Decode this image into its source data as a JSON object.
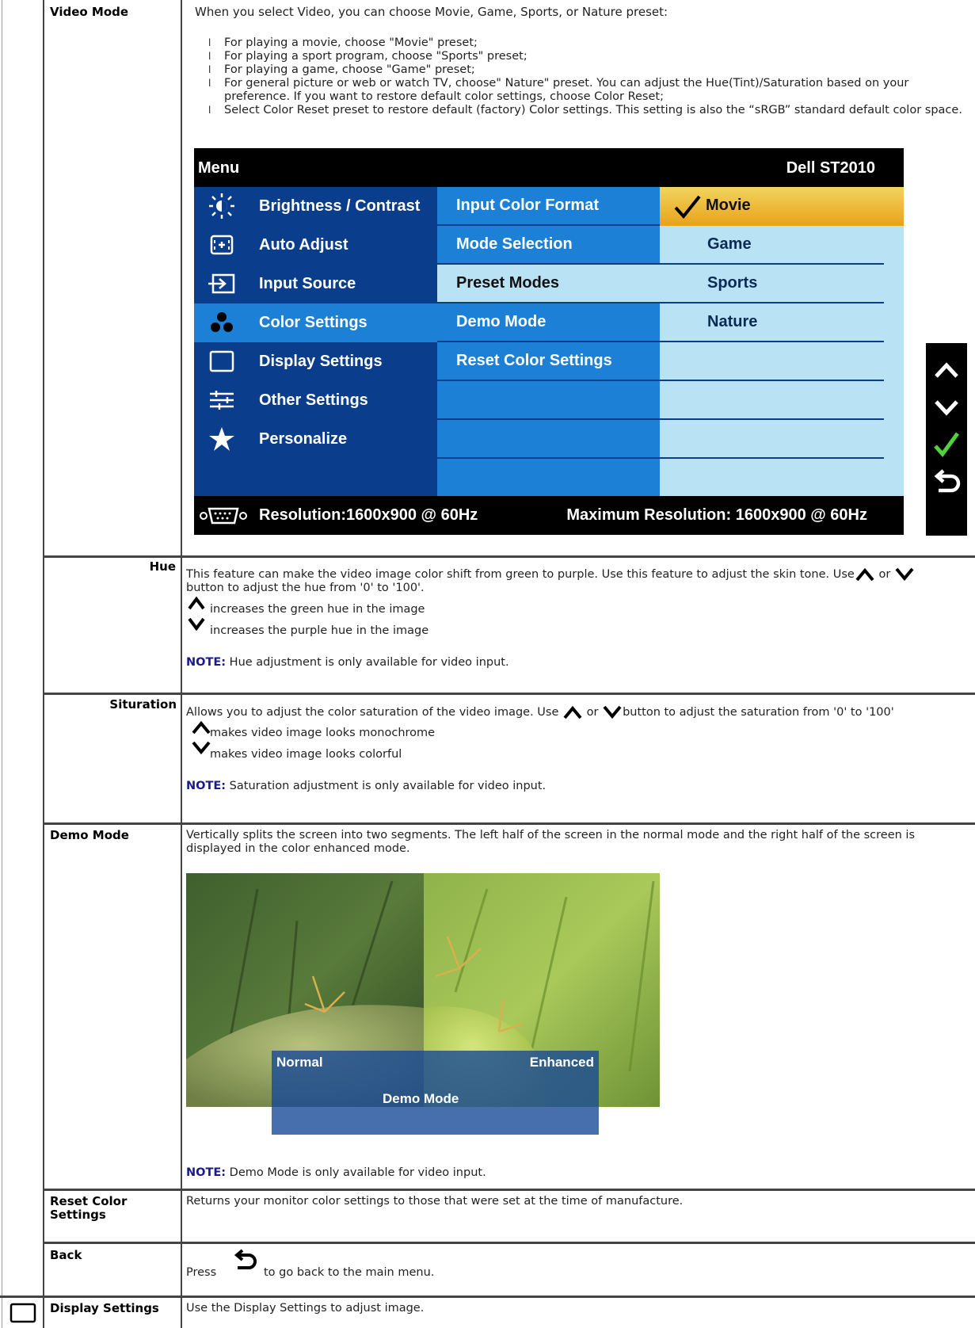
{
  "rows": {
    "video_mode": {
      "label": "Video Mode",
      "intro": "When you select Video, you can choose Movie, Game, Sports, or Nature preset:",
      "bullet_marker": "l",
      "bullets": [
        "For playing a movie, choose \"Movie\" preset;",
        "For playing a sport program, choose \"Sports\" preset;",
        "For playing a game, choose \"Game\" preset;",
        "For general picture or web or watch TV, choose\" Nature\" preset. You can adjust the Hue(Tint)/Saturation based on your preference. If you want to restore default color settings, choose Color Reset;",
        "Select Color Reset preset to restore default (factory) Color settings. This setting is also the “sRGB” standard default color space."
      ]
    },
    "hue": {
      "label": "Hue",
      "desc_a": "This feature can make the video image color shift from green to purple. Use this feature to adjust the skin tone. Use",
      "desc_or": "or",
      "desc_b": "button to adjust the hue from '0' to '100'.",
      "up_text": "increases the green hue in the image",
      "down_text": "increases the purple hue in the image",
      "note_label": "NOTE:",
      "note_text": "Hue adjustment is only available for video input."
    },
    "saturation": {
      "label": "Situration",
      "desc_a": "Allows you to adjust the color saturation of the video image. Use",
      "desc_or": "or",
      "desc_b": "button to adjust the saturation from '0' to '100'",
      "up_text": "makes video image looks monochrome",
      "down_text": "makes video image looks colorful",
      "note_label": "NOTE:",
      "note_text": "Saturation adjustment is only available for video input."
    },
    "demo_mode": {
      "label": "Demo Mode",
      "desc": "Vertically splits the screen into two segments. The left half of the screen in the normal mode and the right half of the screen is displayed in the color enhanced mode.",
      "normal_label": "Normal",
      "enhanced_label": "Enhanced",
      "bar_label": "Demo  Mode",
      "note_label": "NOTE:",
      "note_text": "Demo Mode is only available for video input."
    },
    "reset_color": {
      "label": "Reset Color Settings",
      "desc": "Returns your monitor color settings to those that were set at the time of manufacture."
    },
    "back": {
      "label": "Back",
      "press": "Press",
      "desc": "to go back to the main menu."
    },
    "display_settings": {
      "label": "Display Settings",
      "desc": "Use the Display Settings to adjust image."
    }
  },
  "osd": {
    "menu_title": "Menu",
    "model": "Dell ST2010",
    "left_items": [
      {
        "label": "Brightness / Contrast",
        "icon": "brightness-icon"
      },
      {
        "label": "Auto Adjust",
        "icon": "auto-adjust-icon"
      },
      {
        "label": "Input Source",
        "icon": "input-source-icon"
      },
      {
        "label": "Color Settings",
        "icon": "color-settings-icon"
      },
      {
        "label": "Display Settings",
        "icon": "display-settings-icon"
      },
      {
        "label": "Other Settings",
        "icon": "other-settings-icon"
      },
      {
        "label": "Personalize",
        "icon": "star-icon"
      }
    ],
    "active_left": "Color Settings",
    "mid_items": [
      "Input Color Format",
      "Mode Selection",
      "Preset Modes",
      "Demo Mode",
      "Reset Color Settings",
      "",
      "",
      ""
    ],
    "selected_mid": "Preset Modes",
    "right_items": [
      "Movie",
      "Game",
      "Sports",
      "Nature",
      "",
      "",
      "",
      ""
    ],
    "selected_right": "Movie",
    "resolution": "Resolution:1600x900 @ 60Hz",
    "max_resolution": "Maximum Resolution: 1600x900 @ 60Hz",
    "nav_buttons": [
      "up-arrow-icon",
      "down-arrow-icon",
      "check-icon",
      "back-icon"
    ],
    "colors": {
      "panel_dark": "#0a3e8c",
      "panel_mid": "#1b80d6",
      "panel_light": "#b9e3f5",
      "highlight": "#e8a21a"
    }
  }
}
